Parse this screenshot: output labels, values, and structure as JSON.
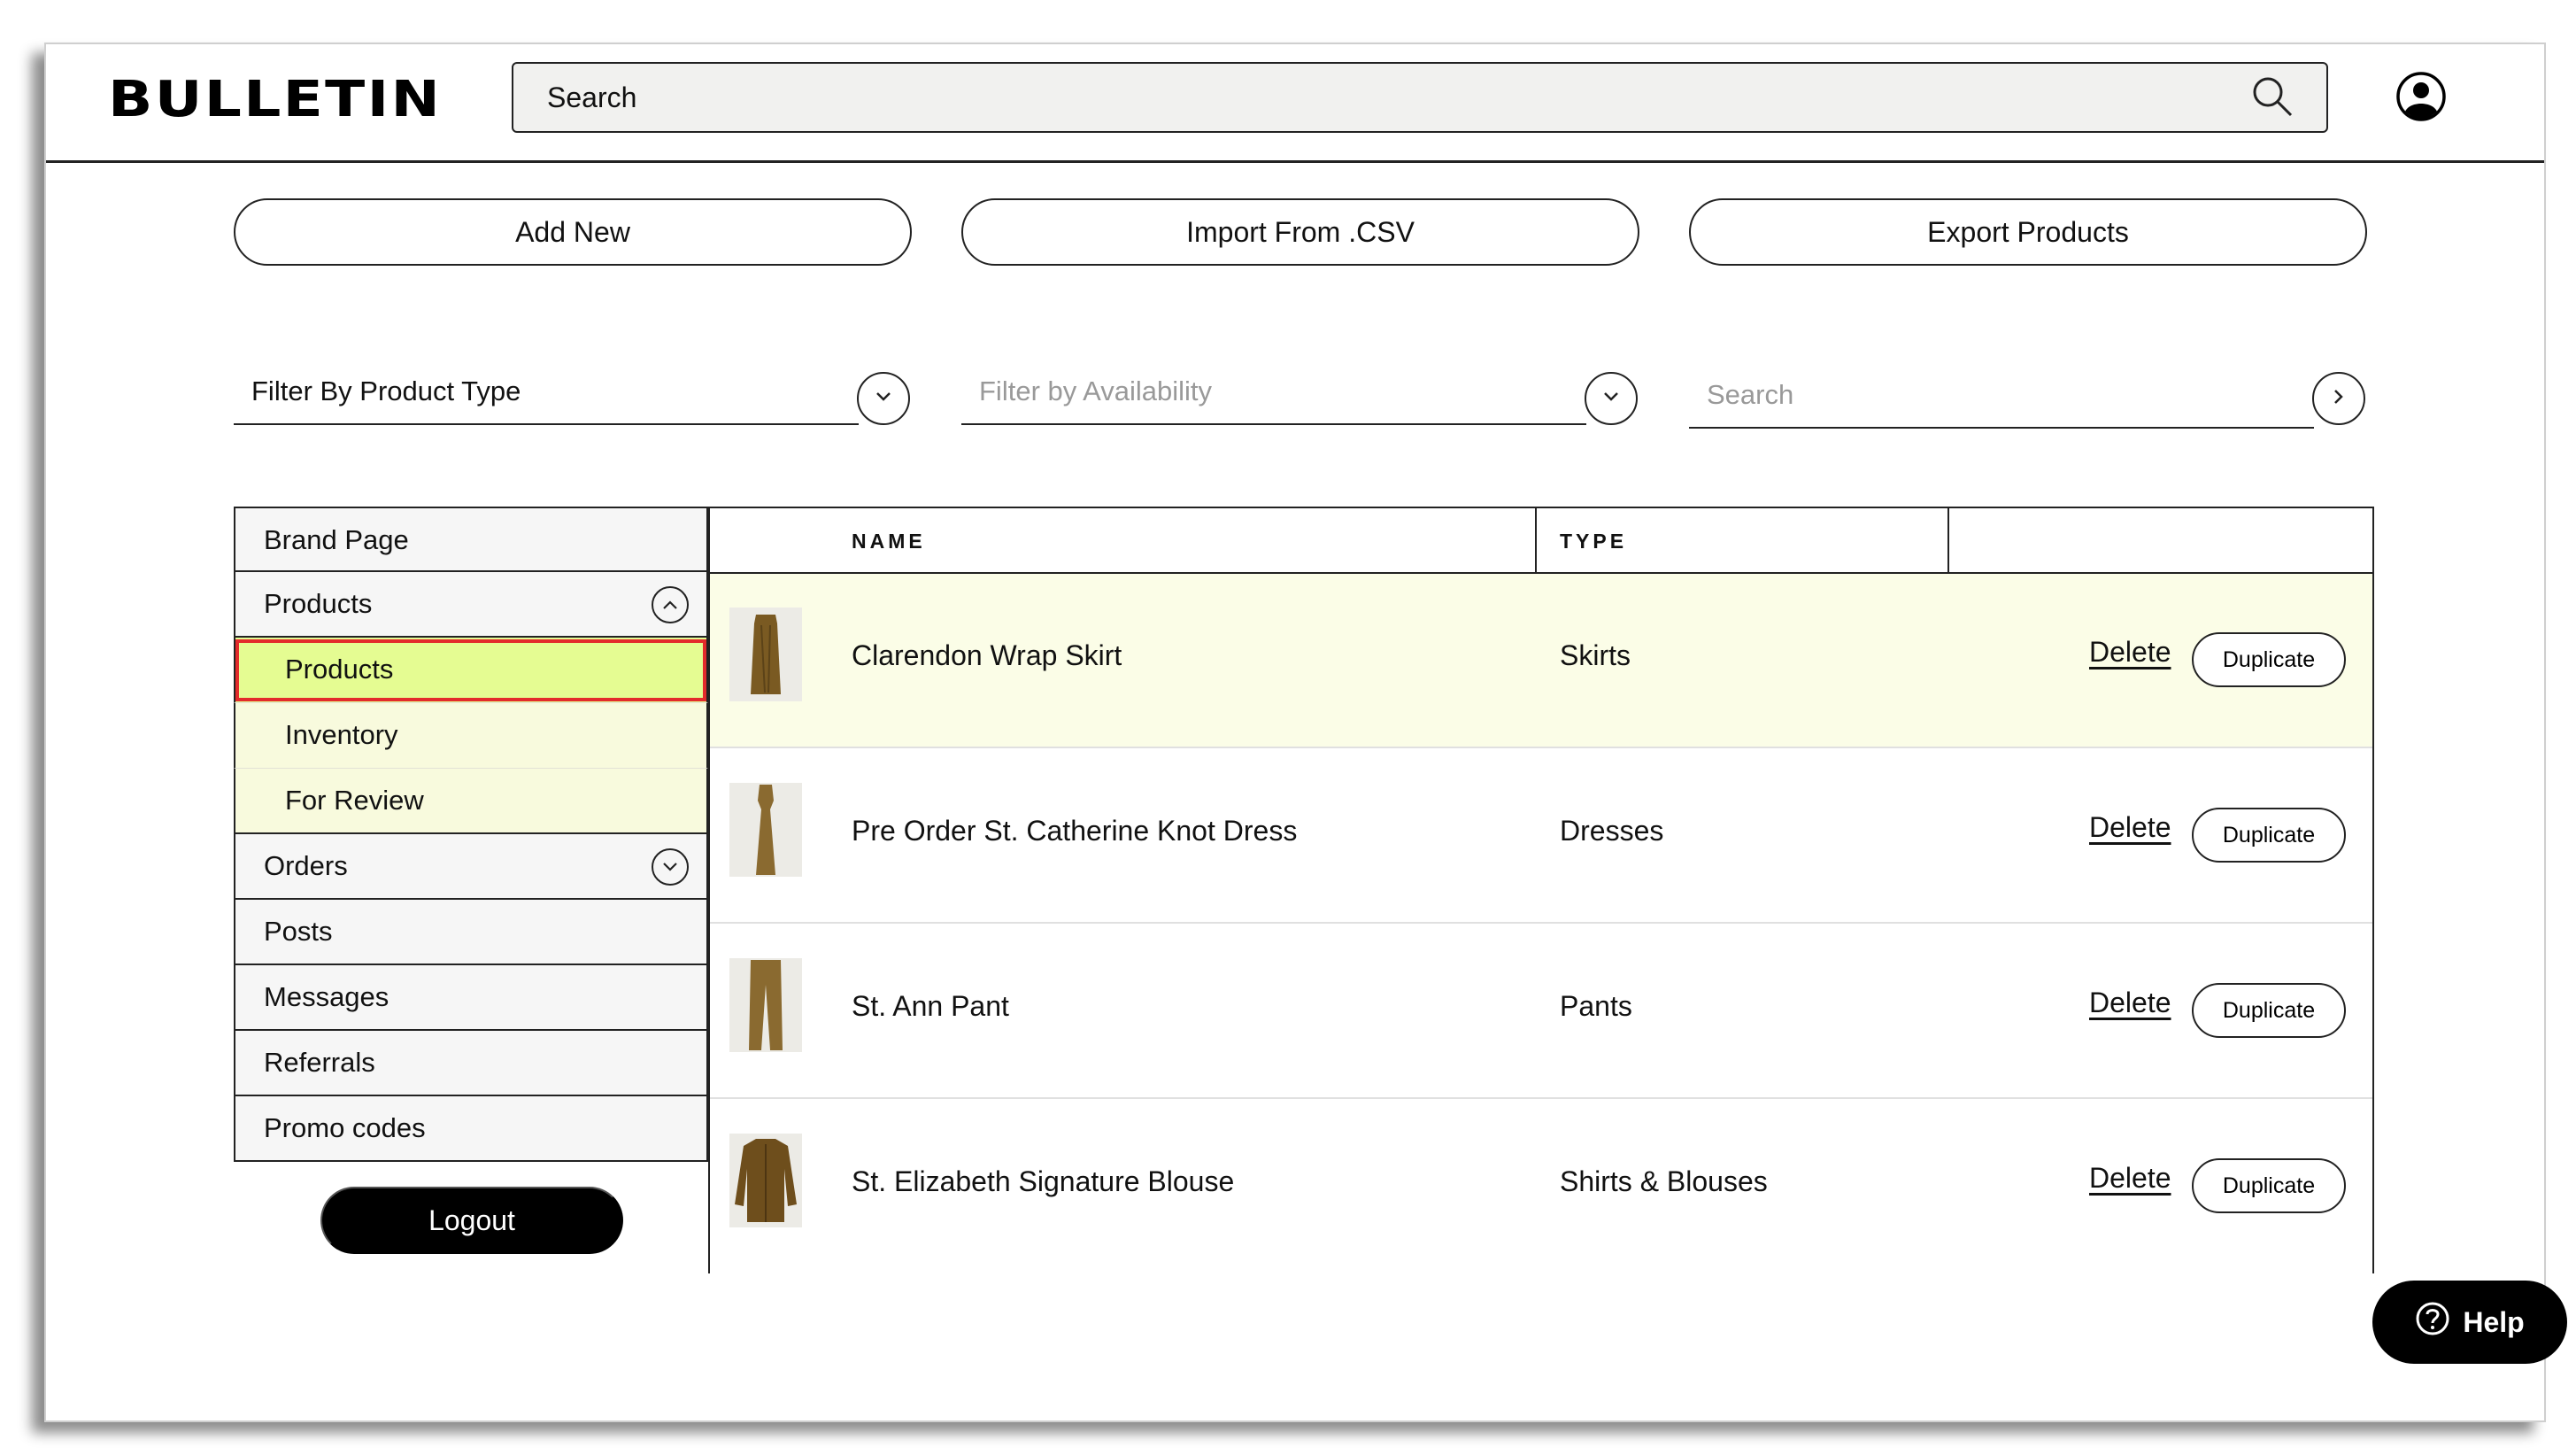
{
  "header": {
    "logo": "BULLETIN",
    "search_placeholder": "Search"
  },
  "actions": {
    "add_new": "Add New",
    "import_csv": "Import From .CSV",
    "export": "Export Products"
  },
  "filters": {
    "product_type": "Filter By Product Type",
    "availability_placeholder": "Filter by Availability",
    "search_placeholder": "Search"
  },
  "sidebar": {
    "brand_page": "Brand Page",
    "products": "Products",
    "sub_products": "Products",
    "sub_inventory": "Inventory",
    "sub_for_review": "For Review",
    "orders": "Orders",
    "posts": "Posts",
    "messages": "Messages",
    "referrals": "Referrals",
    "promo_codes": "Promo codes",
    "logout": "Logout"
  },
  "table": {
    "columns": {
      "name": "NAME",
      "type": "TYPE"
    },
    "delete_label": "Delete",
    "duplicate_label": "Duplicate",
    "rows": [
      {
        "name": "Clarendon Wrap Skirt",
        "type": "Skirts"
      },
      {
        "name": "Pre Order St. Catherine Knot Dress",
        "type": "Dresses"
      },
      {
        "name": "St. Ann Pant",
        "type": "Pants"
      },
      {
        "name": "St. Elizabeth Signature Blouse",
        "type": "Shirts & Blouses"
      }
    ]
  },
  "help": {
    "label": "Help"
  },
  "colors": {
    "active_bg": "#e5fc92",
    "active_border": "#e32b2b",
    "highlight_row": "#fbfde7",
    "product_olive": "#7a5a22"
  }
}
